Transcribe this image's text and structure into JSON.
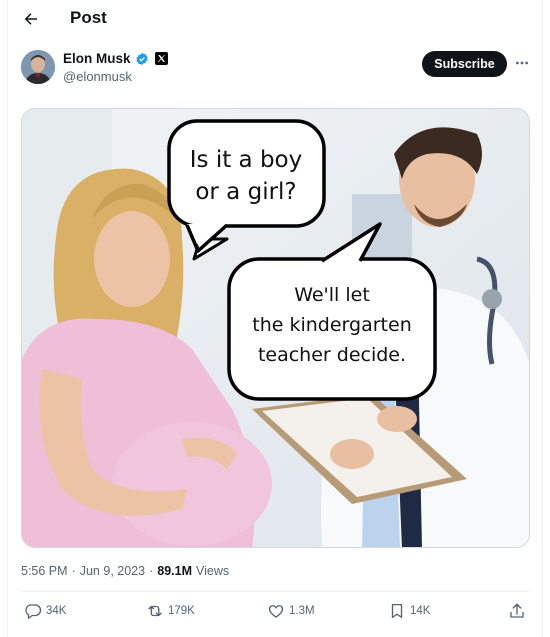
{
  "header": {
    "title": "Post"
  },
  "author": {
    "name": "Elon Musk",
    "handle": "@elonmusk",
    "subscribe_label": "Subscribe"
  },
  "media": {
    "bubble_top_line1": "Is it a boy",
    "bubble_top_line2": "or a girl?",
    "bubble_bottom_line1": "We'll let",
    "bubble_bottom_line2": "the kindergarten",
    "bubble_bottom_line3": "teacher decide."
  },
  "meta": {
    "time": "5:56 PM",
    "separator": "·",
    "date": "Jun 9, 2023",
    "separator2": "·",
    "views_count": "89.1M",
    "views_label": "Views"
  },
  "actions": {
    "replies": "34K",
    "reposts": "179K",
    "likes": "1.3M",
    "bookmarks": "14K"
  },
  "colors": {
    "accent": "#1d9bf0",
    "text": "#0f1419",
    "muted": "#536471"
  },
  "icons": [
    "back-arrow-icon",
    "verified-badge-icon",
    "x-logo-icon",
    "more-icon",
    "reply-icon",
    "repost-icon",
    "like-icon",
    "bookmark-icon",
    "share-icon"
  ]
}
